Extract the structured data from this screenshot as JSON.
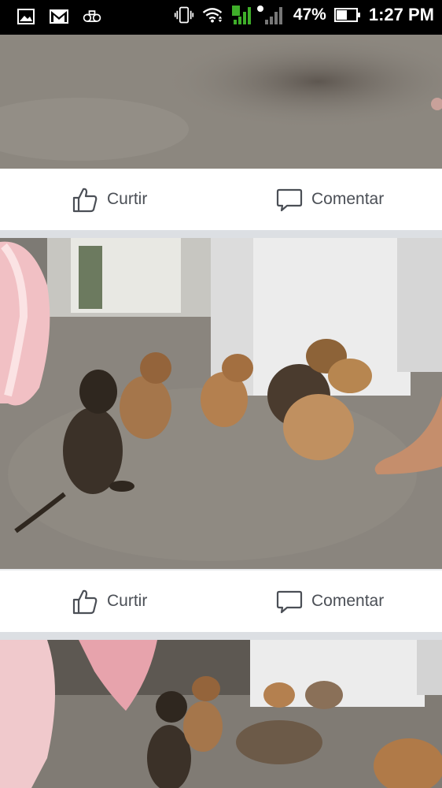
{
  "statusbar": {
    "left_icons": [
      "gallery-icon",
      "gmail-icon",
      "voicemail-icon"
    ],
    "right_icons": [
      "vibrate-icon",
      "wifi-icon",
      "cell-signal-icon"
    ],
    "battery": "47%",
    "time": "1:27 PM"
  },
  "posts": [
    {
      "photo": "concrete floor",
      "like_label": "Curtir",
      "comment_label": "Comentar"
    },
    {
      "photo": "puppies looking up",
      "like_label": "Curtir",
      "comment_label": "Comentar"
    },
    {
      "photo": "puppies walking"
    }
  ],
  "colors": {
    "bar_bg": "#000000",
    "action_text": "#4b4f56",
    "feed_bg": "#e9ebee"
  }
}
